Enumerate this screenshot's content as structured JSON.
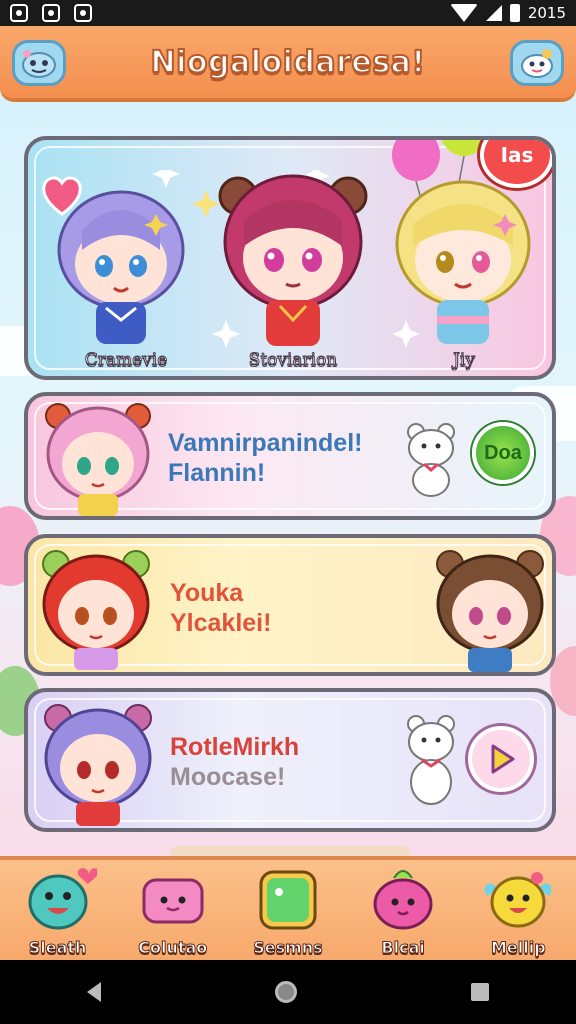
{
  "status_bar": {
    "time": "2015",
    "icons": [
      "notification-icon",
      "alarm-icon",
      "app-icon",
      "wifi-icon",
      "signal-icon",
      "battery-icon"
    ]
  },
  "header": {
    "title": "Niogaloidaresa!",
    "left_icon": "stone-creature-icon",
    "right_icon": "creature-icon"
  },
  "featured": {
    "badge": "Ias",
    "characters": [
      {
        "name": "Cramevie"
      },
      {
        "name": "Stoviarion"
      },
      {
        "name": "Jiy"
      }
    ]
  },
  "rows": [
    {
      "line1": "Vamnirpanindel!",
      "line2": "Flannin!",
      "button_label": "Doa",
      "color": "#3b78b7"
    },
    {
      "line1": "Youka",
      "line2": "Ylcaklei!",
      "color": "#e0543a"
    },
    {
      "line1": "RotleMirkh",
      "line2": "Moocase!",
      "color1": "#d8433a",
      "color2": "#9a8e94"
    }
  ],
  "bottom_nav": [
    {
      "label": "Sleath",
      "icon": "smiling-blob-icon"
    },
    {
      "label": "Colutao",
      "icon": "pink-box-icon"
    },
    {
      "label": "Sesmns",
      "icon": "green-cube-icon"
    },
    {
      "label": "Blcai",
      "icon": "pink-creature-icon"
    },
    {
      "label": "Mellip",
      "icon": "yellow-creature-icon"
    }
  ]
}
